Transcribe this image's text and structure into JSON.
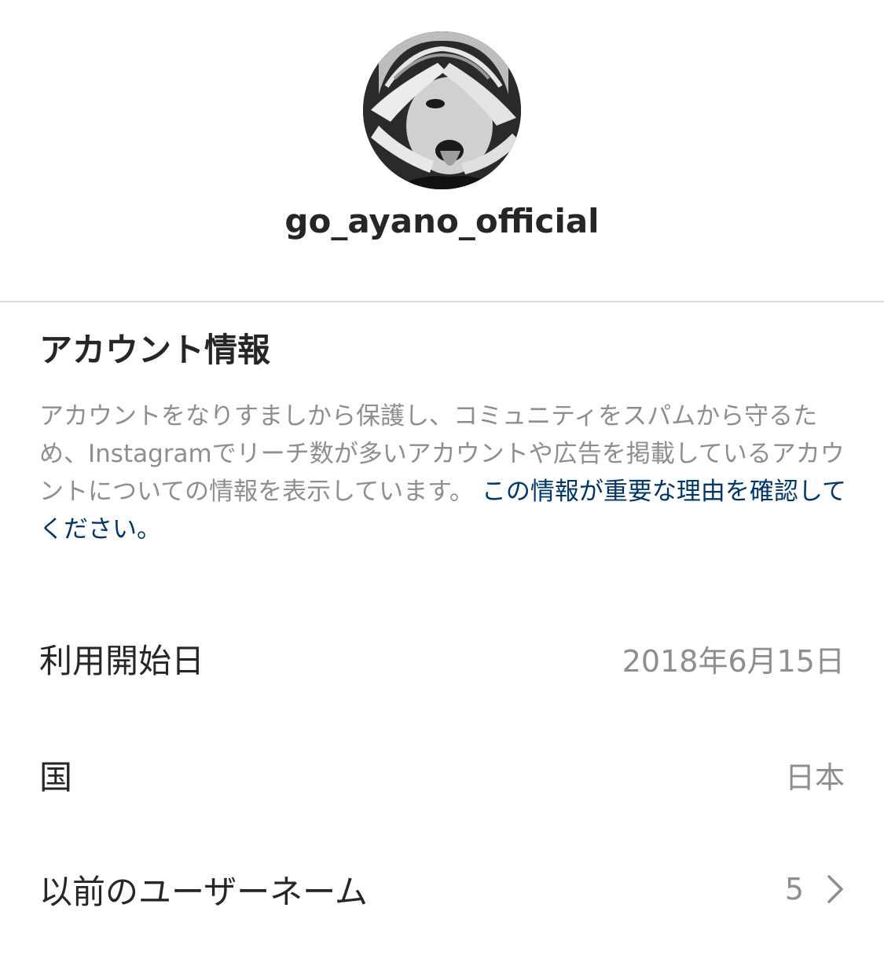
{
  "profile": {
    "username": "go_ayano_official",
    "avatar_icon": "profile-photo"
  },
  "account_info": {
    "title": "アカウント情報",
    "description": "アカウントをなりすましから保護し、コミュニティをスパムから守るため、Instagramでリーチ数が多いアカウントや広告を掲載しているアカウントについての情報を表示しています。",
    "link_text": " この情報が重要な理由を確認してください。"
  },
  "rows": {
    "start_date": {
      "label": "利用開始日",
      "value": "2018年6月15日"
    },
    "country": {
      "label": "国",
      "value": "日本"
    },
    "previous_usernames": {
      "label": "以前のユーザーネーム",
      "value": "5",
      "icon": "chevron-right-icon"
    }
  },
  "colors": {
    "text_primary": "#262626",
    "text_secondary": "#8e8e8e",
    "link": "#00376b",
    "divider": "#dbdbdb"
  }
}
